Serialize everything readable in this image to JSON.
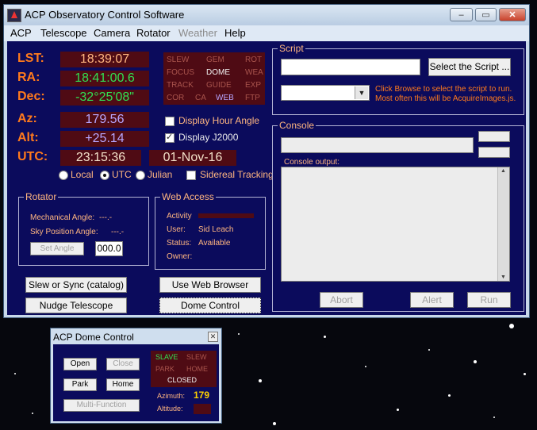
{
  "main_window": {
    "title": "ACP Observatory Control Software",
    "controls": {
      "minimize": "–",
      "maximize": "▭",
      "close": "✕"
    }
  },
  "menu": [
    "ACP",
    "Telescope",
    "Camera",
    "Rotator",
    "Weather",
    "Help"
  ],
  "coords": {
    "lst_label": "LST:",
    "lst": "18:39:07",
    "ra_label": "RA:",
    "ra": "18:41:00.6",
    "dec_label": "Dec:",
    "dec": "-32°25'08\"",
    "az_label": "Az:",
    "az": "179.56",
    "alt_label": "Alt:",
    "alt": "+25.14",
    "utc_label": "UTC:",
    "utc": "23:15:36",
    "date": "01-Nov-16"
  },
  "status_grid": {
    "slew": "SLEW",
    "gem": "GEM",
    "rot": "ROT",
    "focus": "FOCUS",
    "dome": "DOME",
    "wea": "WEA",
    "track": "TRACK",
    "guide": "GUIDE",
    "exp": "EXP",
    "cor": "COR",
    "ca": "CA",
    "web": "WEB",
    "ftp": "FTP"
  },
  "options": {
    "hour_angle": "Display Hour Angle",
    "j2000": "Display J2000",
    "local": "Local",
    "utc": "UTC",
    "julian": "Julian",
    "sidereal": "Sidereal Tracking"
  },
  "rotator": {
    "title": "Rotator",
    "mech_label": "Mechanical Angle:",
    "mech_value": "---.-",
    "sky_label": "Sky Position Angle:",
    "sky_value": "---.-",
    "set_angle": "Set Angle",
    "angle_input": "000.0"
  },
  "web_access": {
    "title": "Web Access",
    "activity": "Activity",
    "user_label": "User:",
    "user": "Sid Leach",
    "status_label": "Status:",
    "status": "Available",
    "owner_label": "Owner:",
    "owner": ""
  },
  "buttons": {
    "slew_sync": "Slew or Sync (catalog)",
    "use_browser": "Use Web Browser",
    "nudge": "Nudge Telescope",
    "dome_control": "Dome Control"
  },
  "script": {
    "title": "Script",
    "select": "Select the Script ...",
    "hint": "Click Browse to select the script to run.",
    "hint2": "Most often this will be AcquireImages.js."
  },
  "console": {
    "title": "Console",
    "output_label": "Console output:",
    "abort": "Abort",
    "alert": "Alert",
    "run": "Run"
  },
  "dome": {
    "title": "ACP Dome Control",
    "open": "Open",
    "close": "Close",
    "park": "Park",
    "home": "Home",
    "multi": "Multi-Function",
    "slave": "SLAVE",
    "slew": "SLEW",
    "park_st": "PARK",
    "home_st": "HOME",
    "closed": "CLOSED",
    "azimuth_label": "Azimuth:",
    "azimuth": "179",
    "altitude_label": "Altitude:",
    "altitude": ""
  }
}
